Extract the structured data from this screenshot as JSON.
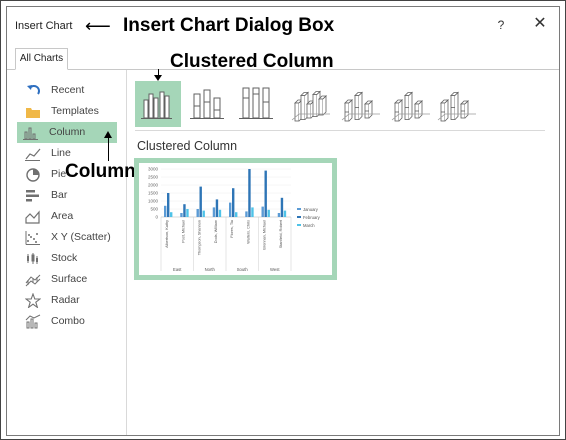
{
  "dialog": {
    "title": "Insert Chart",
    "help_label": "?",
    "close_label": "✕"
  },
  "annotations": {
    "dialog_box": "Insert Chart Dialog Box",
    "clustered_column": "Clustered Column",
    "column": "Column"
  },
  "tabs": [
    {
      "label": "All Charts"
    }
  ],
  "categories": [
    {
      "label": "Recent",
      "icon": "undo-arrow-icon"
    },
    {
      "label": "Templates",
      "icon": "folder-icon"
    },
    {
      "label": "Column",
      "icon": "column-chart-icon"
    },
    {
      "label": "Line",
      "icon": "line-chart-icon"
    },
    {
      "label": "Pie",
      "icon": "pie-chart-icon"
    },
    {
      "label": "Bar",
      "icon": "bar-chart-icon"
    },
    {
      "label": "Area",
      "icon": "area-chart-icon"
    },
    {
      "label": "X Y (Scatter)",
      "icon": "scatter-chart-icon"
    },
    {
      "label": "Stock",
      "icon": "stock-chart-icon"
    },
    {
      "label": "Surface",
      "icon": "surface-chart-icon"
    },
    {
      "label": "Radar",
      "icon": "radar-chart-icon"
    },
    {
      "label": "Combo",
      "icon": "combo-chart-icon"
    }
  ],
  "selected_category": "Column",
  "subtypes": [
    {
      "name": "Clustered Column",
      "icon": "clustered-column-icon",
      "selected": true
    },
    {
      "name": "Stacked Column",
      "icon": "stacked-column-icon",
      "selected": false
    },
    {
      "name": "100% Stacked Column",
      "icon": "100-stacked-column-icon",
      "selected": false
    },
    {
      "name": "3-D Clustered Column",
      "icon": "3d-clustered-column-icon",
      "selected": false
    },
    {
      "name": "3-D Stacked Column",
      "icon": "3d-stacked-column-icon",
      "selected": false
    },
    {
      "name": "3-D 100% Stacked Column",
      "icon": "3d-100-stacked-column-icon",
      "selected": false
    },
    {
      "name": "3-D Column",
      "icon": "3d-column-icon",
      "selected": false
    }
  ],
  "preview": {
    "title": "Clustered Column",
    "y_ticks": [
      "3000",
      "2500",
      "2000",
      "1500",
      "1000",
      "500",
      "0"
    ],
    "names": [
      "Albertson, Kathy",
      "Post, Michael",
      "Thompson, Shannon",
      "Dods, William",
      "Flores, Tia",
      "Walters, Chris",
      "Brennan, Michael",
      "Stanfield, Robert"
    ],
    "regions": [
      "East",
      "North",
      "South",
      "West"
    ],
    "legend": [
      "January",
      "February",
      "March"
    ],
    "colors": {
      "January": "#5b9bd5",
      "February": "#2e75b6",
      "March": "#4fc3e8"
    }
  }
}
